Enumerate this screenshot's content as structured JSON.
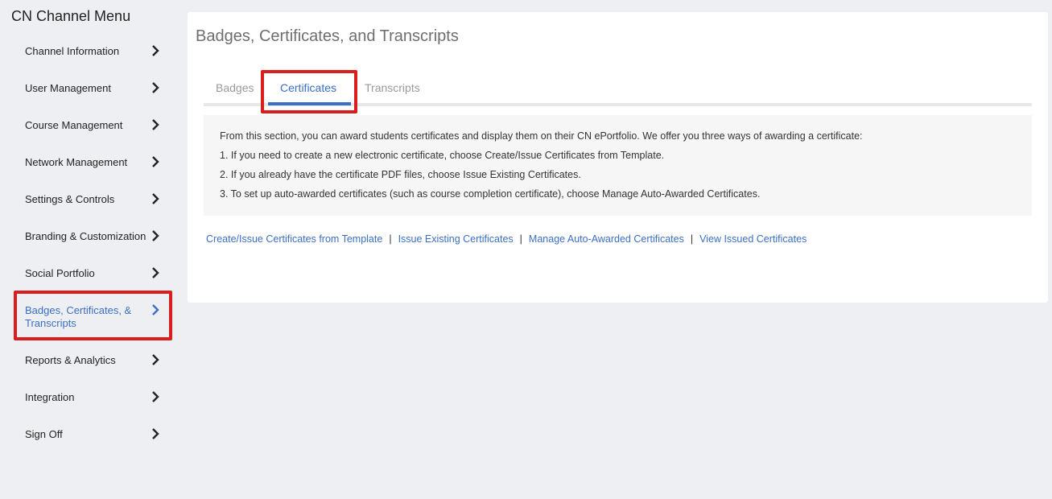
{
  "sidebar": {
    "title": "CN Channel Menu",
    "items": [
      {
        "label": "Channel Information"
      },
      {
        "label": "User Management"
      },
      {
        "label": "Course Management"
      },
      {
        "label": "Network Management"
      },
      {
        "label": "Settings & Controls"
      },
      {
        "label": "Branding & Customization"
      },
      {
        "label": "Social Portfolio"
      },
      {
        "label": "Badges, Certificates, & Transcripts"
      },
      {
        "label": "Reports & Analytics"
      },
      {
        "label": "Integration"
      },
      {
        "label": "Sign Off"
      }
    ],
    "chevron_icon": "chevron-right-icon",
    "active_color": "#3a6fc4"
  },
  "main": {
    "title": "Badges, Certificates, and Transcripts",
    "tabs": [
      {
        "label": "Badges"
      },
      {
        "label": "Certificates"
      },
      {
        "label": "Transcripts"
      }
    ],
    "info": {
      "intro": "From this section, you can award students certificates and display them on their CN ePortfolio. We offer you three ways of awarding a certificate:",
      "step1": "1. If you need to create a new electronic certificate, choose Create/Issue Certificates from Template.",
      "step2": "2. If you already have the certificate PDF files, choose Issue Existing Certificates.",
      "step3": "3. To set up auto-awarded certificates (such as course completion certificate), choose Manage Auto-Awarded Certificates."
    },
    "links": {
      "create": "Create/Issue Certificates from Template",
      "issue": "Issue Existing Certificates",
      "manage": "Manage Auto-Awarded Certificates",
      "view": "View Issued Certificates",
      "separator": "|"
    }
  },
  "colors": {
    "highlight": "#d81e1e",
    "accent": "#3a6fc4",
    "background": "#eeeff2"
  }
}
